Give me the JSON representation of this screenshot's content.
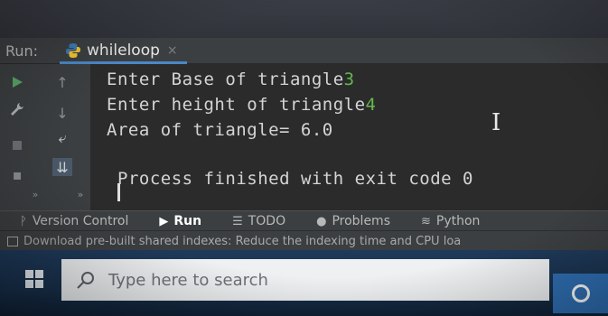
{
  "run_panel": {
    "label": "Run:",
    "tab": {
      "name": "whileloop",
      "close": "×"
    }
  },
  "console": {
    "lines": [
      {
        "text": "Enter Base of triangle",
        "input": "3"
      },
      {
        "text": "Enter height of triangle",
        "input": "4"
      },
      {
        "text": "Area of triangle= 6.0"
      },
      {
        "text": ""
      },
      {
        "text": "Process finished with exit code 0"
      }
    ],
    "input_color": "#63b84d"
  },
  "gutter_icons": [
    "run-icon",
    "up-arrow-icon",
    "wrench-icon",
    "down-arrow-icon",
    "stop-icon",
    "soft-wrap-icon",
    "scroll-to-end-icon",
    "more-icon"
  ],
  "tool_tabs": [
    {
      "label": "Version Control",
      "icon": "vcs-icon"
    },
    {
      "label": "Run",
      "icon": "run-icon",
      "active": true
    },
    {
      "label": "TODO",
      "icon": "todo-icon"
    },
    {
      "label": "Problems",
      "icon": "problems-icon"
    },
    {
      "label": "Python",
      "icon": "python-icon"
    }
  ],
  "status_bar": {
    "message": "Download pre-built shared indexes: Reduce the indexing time and CPU loa"
  },
  "taskbar": {
    "search_placeholder": "Type here to search"
  },
  "colors": {
    "accent": "#4a88c7",
    "console_bg": "#2b2b2b",
    "panel_bg": "#3c3f41"
  }
}
